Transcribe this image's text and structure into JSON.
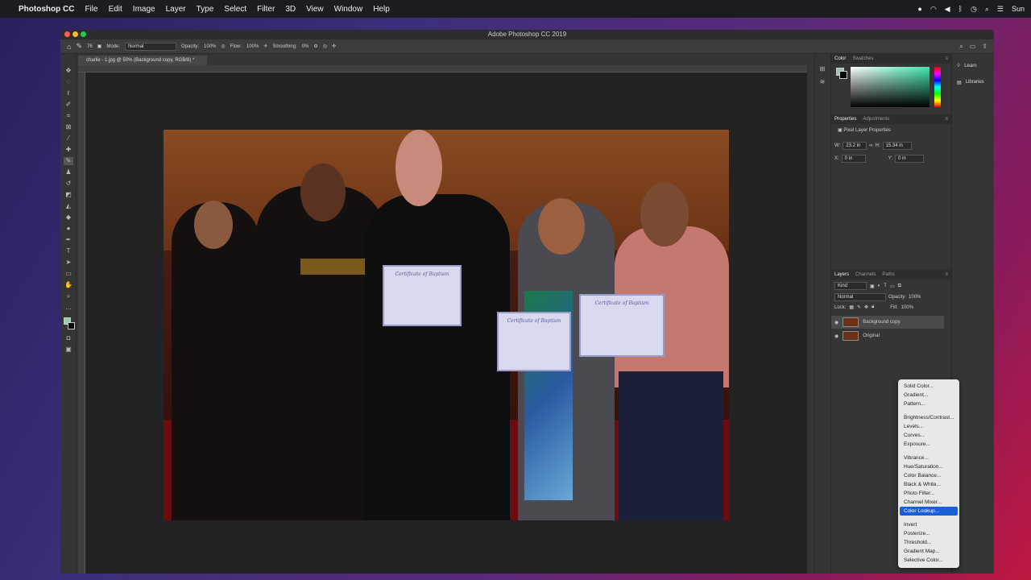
{
  "menubar": {
    "app": "Photoshop CC",
    "items": [
      "File",
      "Edit",
      "Image",
      "Layer",
      "Type",
      "Select",
      "Filter",
      "3D",
      "View",
      "Window",
      "Help"
    ],
    "user": "Sun"
  },
  "window": {
    "title": "Adobe Photoshop CC 2019"
  },
  "optionsbar": {
    "size": "76",
    "mode_label": "Mode:",
    "mode_value": "Normal",
    "opacity_label": "Opacity:",
    "opacity_value": "100%",
    "flow_label": "Flow:",
    "flow_value": "100%",
    "smoothing_label": "Smoothing:",
    "smoothing_value": "0%"
  },
  "document": {
    "tab": "charlie - 1.jpg @ 50% (Background copy, RGB/8) *"
  },
  "color_panel": {
    "tabs": [
      "Color",
      "Swatches"
    ]
  },
  "properties": {
    "tabs": [
      "Properties",
      "Adjustments"
    ],
    "header": "Pixel Layer Properties",
    "w_label": "W:",
    "w_value": "23.2 in",
    "h_label": "H:",
    "h_value": "15.34 in",
    "x_label": "X:",
    "x_value": "0 in",
    "y_label": "Y:",
    "y_value": "0 in"
  },
  "layers_panel": {
    "tabs": [
      "Layers",
      "Channels",
      "Paths"
    ],
    "kind_label": "Kind",
    "blend": "Normal",
    "opacity_label": "Opacity:",
    "opacity_value": "100%",
    "lock_label": "Lock:",
    "fill_label": "Fill:",
    "fill_value": "100%",
    "layers": [
      "Background copy",
      "Original"
    ]
  },
  "learn": {
    "learn": "Learn",
    "libraries": "Libraries"
  },
  "adjust_menu": {
    "group1": [
      "Solid Color...",
      "Gradient...",
      "Pattern..."
    ],
    "group2": [
      "Brightness/Contrast...",
      "Levels...",
      "Curves...",
      "Exposure..."
    ],
    "group3": [
      "Vibrance...",
      "Hue/Saturation...",
      "Color Balance...",
      "Black & White...",
      "Photo Filter...",
      "Channel Mixer...",
      "Color Lookup..."
    ],
    "group4": [
      "Invert",
      "Posterize...",
      "Threshold...",
      "Gradient Map...",
      "Selective Color..."
    ],
    "selected": "Color Lookup..."
  },
  "photo": {
    "certificate": "Certificate of Baptism"
  },
  "colors": {
    "accent": "#1a5fd6",
    "menu_bg": "#e8e8e8",
    "panel_bg": "#353535"
  }
}
